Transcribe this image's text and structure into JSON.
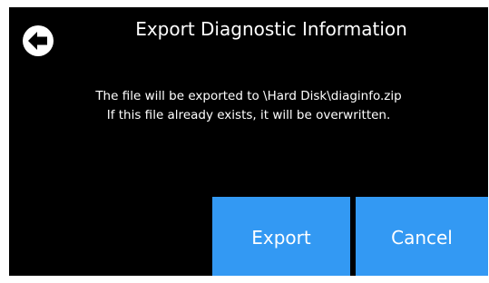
{
  "dialog": {
    "title": "Export Diagnostic Information",
    "back_icon": "back-arrow-icon",
    "message_line_1": "The file will be exported to \\Hard Disk\\diaginfo.zip",
    "message_line_2": "If this file already exists, it will be overwritten."
  },
  "buttons": {
    "export_label": "Export",
    "cancel_label": "Cancel"
  },
  "colors": {
    "background": "#000000",
    "button": "#3399f3",
    "text": "#ffffff"
  }
}
